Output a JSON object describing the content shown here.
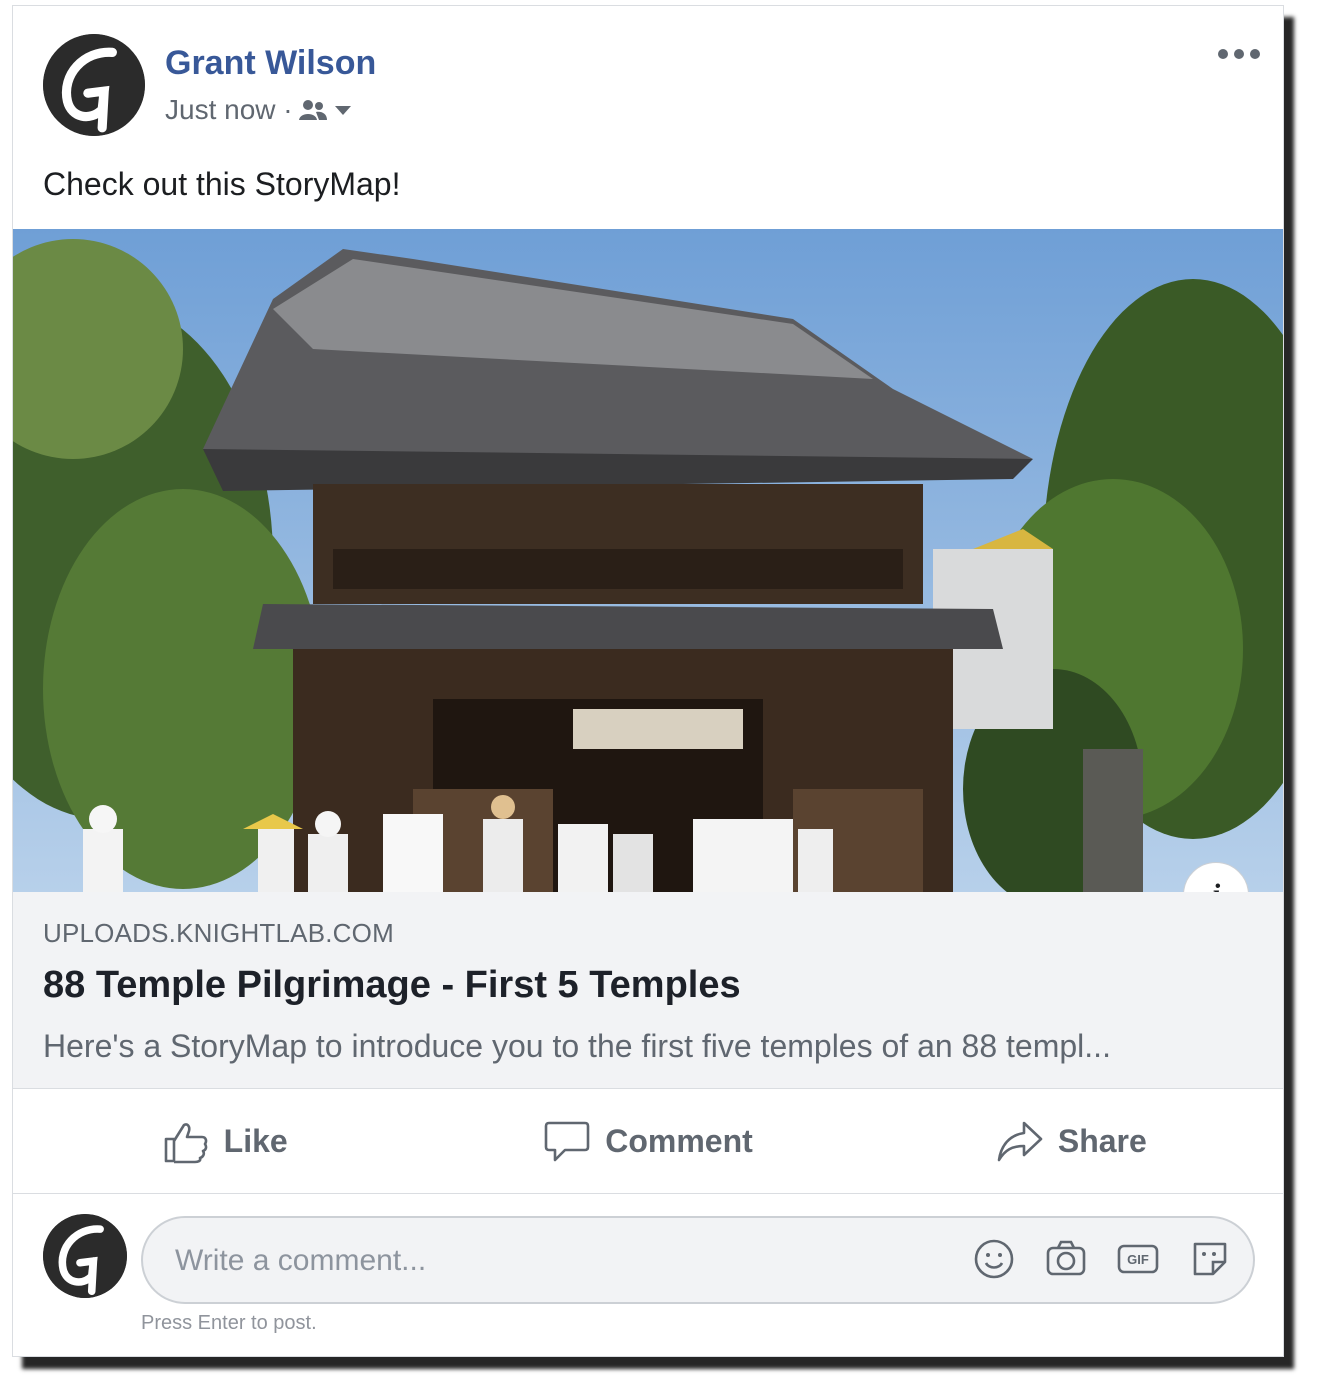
{
  "post": {
    "author": "Grant Wilson",
    "timestamp": "Just now ·",
    "audience_icon": "friends-icon",
    "text": "Check out this StoryMap!"
  },
  "link_preview": {
    "domain": "UPLOADS.KNIGHTLAB.COM",
    "title": "88 Temple Pilgrimage - First 5 Temples",
    "description": "Here's a StoryMap to introduce you to the first five temples of an 88 templ...",
    "info_label": "i"
  },
  "actions": {
    "like": "Like",
    "comment": "Comment",
    "share": "Share"
  },
  "comment_box": {
    "placeholder": "Write a comment...",
    "hint": "Press Enter to post.",
    "icons": [
      "emoji-icon",
      "camera-icon",
      "gif-icon",
      "sticker-icon"
    ]
  },
  "colors": {
    "author_link": "#385898",
    "secondary_text": "#606770",
    "link_box_bg": "#f2f3f5"
  }
}
